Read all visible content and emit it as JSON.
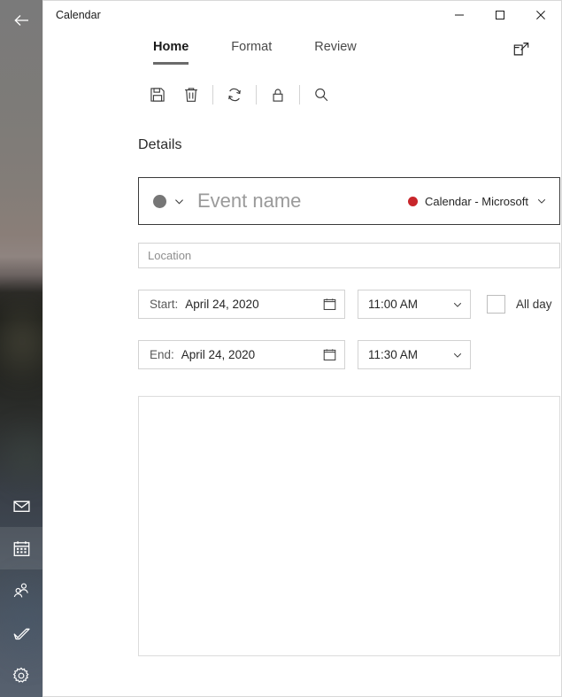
{
  "window": {
    "title": "Calendar",
    "controls": {
      "minimize": "minimize-icon",
      "maximize": "maximize-icon",
      "close": "close-icon"
    }
  },
  "rail": {
    "back_icon": "back-arrow-icon",
    "items": [
      {
        "icon": "mail-icon",
        "label": "Mail",
        "selected": false
      },
      {
        "icon": "calendar-icon",
        "label": "Calendar",
        "selected": true
      },
      {
        "icon": "people-icon",
        "label": "People",
        "selected": false
      },
      {
        "icon": "tasks-icon",
        "label": "To Do",
        "selected": false
      },
      {
        "icon": "settings-gear-icon",
        "label": "Settings",
        "selected": false
      }
    ]
  },
  "ribbon": {
    "tabs": [
      {
        "label": "Home",
        "active": true
      },
      {
        "label": "Format",
        "active": false
      },
      {
        "label": "Review",
        "active": false
      }
    ],
    "popout_icon": "open-in-new-window-icon",
    "commands": [
      {
        "icon": "save-icon",
        "label": "Save"
      },
      {
        "icon": "delete-trash-icon",
        "label": "Delete"
      },
      {
        "separator": true
      },
      {
        "icon": "repeat-recurrence-icon",
        "label": "Repeat"
      },
      {
        "separator": true
      },
      {
        "icon": "lock-private-icon",
        "label": "Private"
      },
      {
        "separator": true
      },
      {
        "icon": "search-icon",
        "label": "Search"
      }
    ]
  },
  "details": {
    "heading": "Details",
    "event": {
      "category_color": "#767676",
      "category_chevron": "chevron-down-icon",
      "name_value": "",
      "name_placeholder": "Event name",
      "calendar": {
        "color": "#c8262b",
        "name": "Calendar - Microsoft",
        "chevron": "chevron-down-icon"
      }
    },
    "location": {
      "value": "",
      "placeholder": "Location"
    },
    "start": {
      "label": "Start:",
      "date": "April 24, 2020",
      "date_icon": "calendar-picker-icon",
      "time": "11:00 AM",
      "time_chevron": "chevron-down-icon"
    },
    "end": {
      "label": "End:",
      "date": "April 24, 2020",
      "date_icon": "calendar-picker-icon",
      "time": "11:30 AM",
      "time_chevron": "chevron-down-icon"
    },
    "all_day": {
      "label": "All day",
      "checked": false
    },
    "notes": {
      "value": ""
    }
  }
}
